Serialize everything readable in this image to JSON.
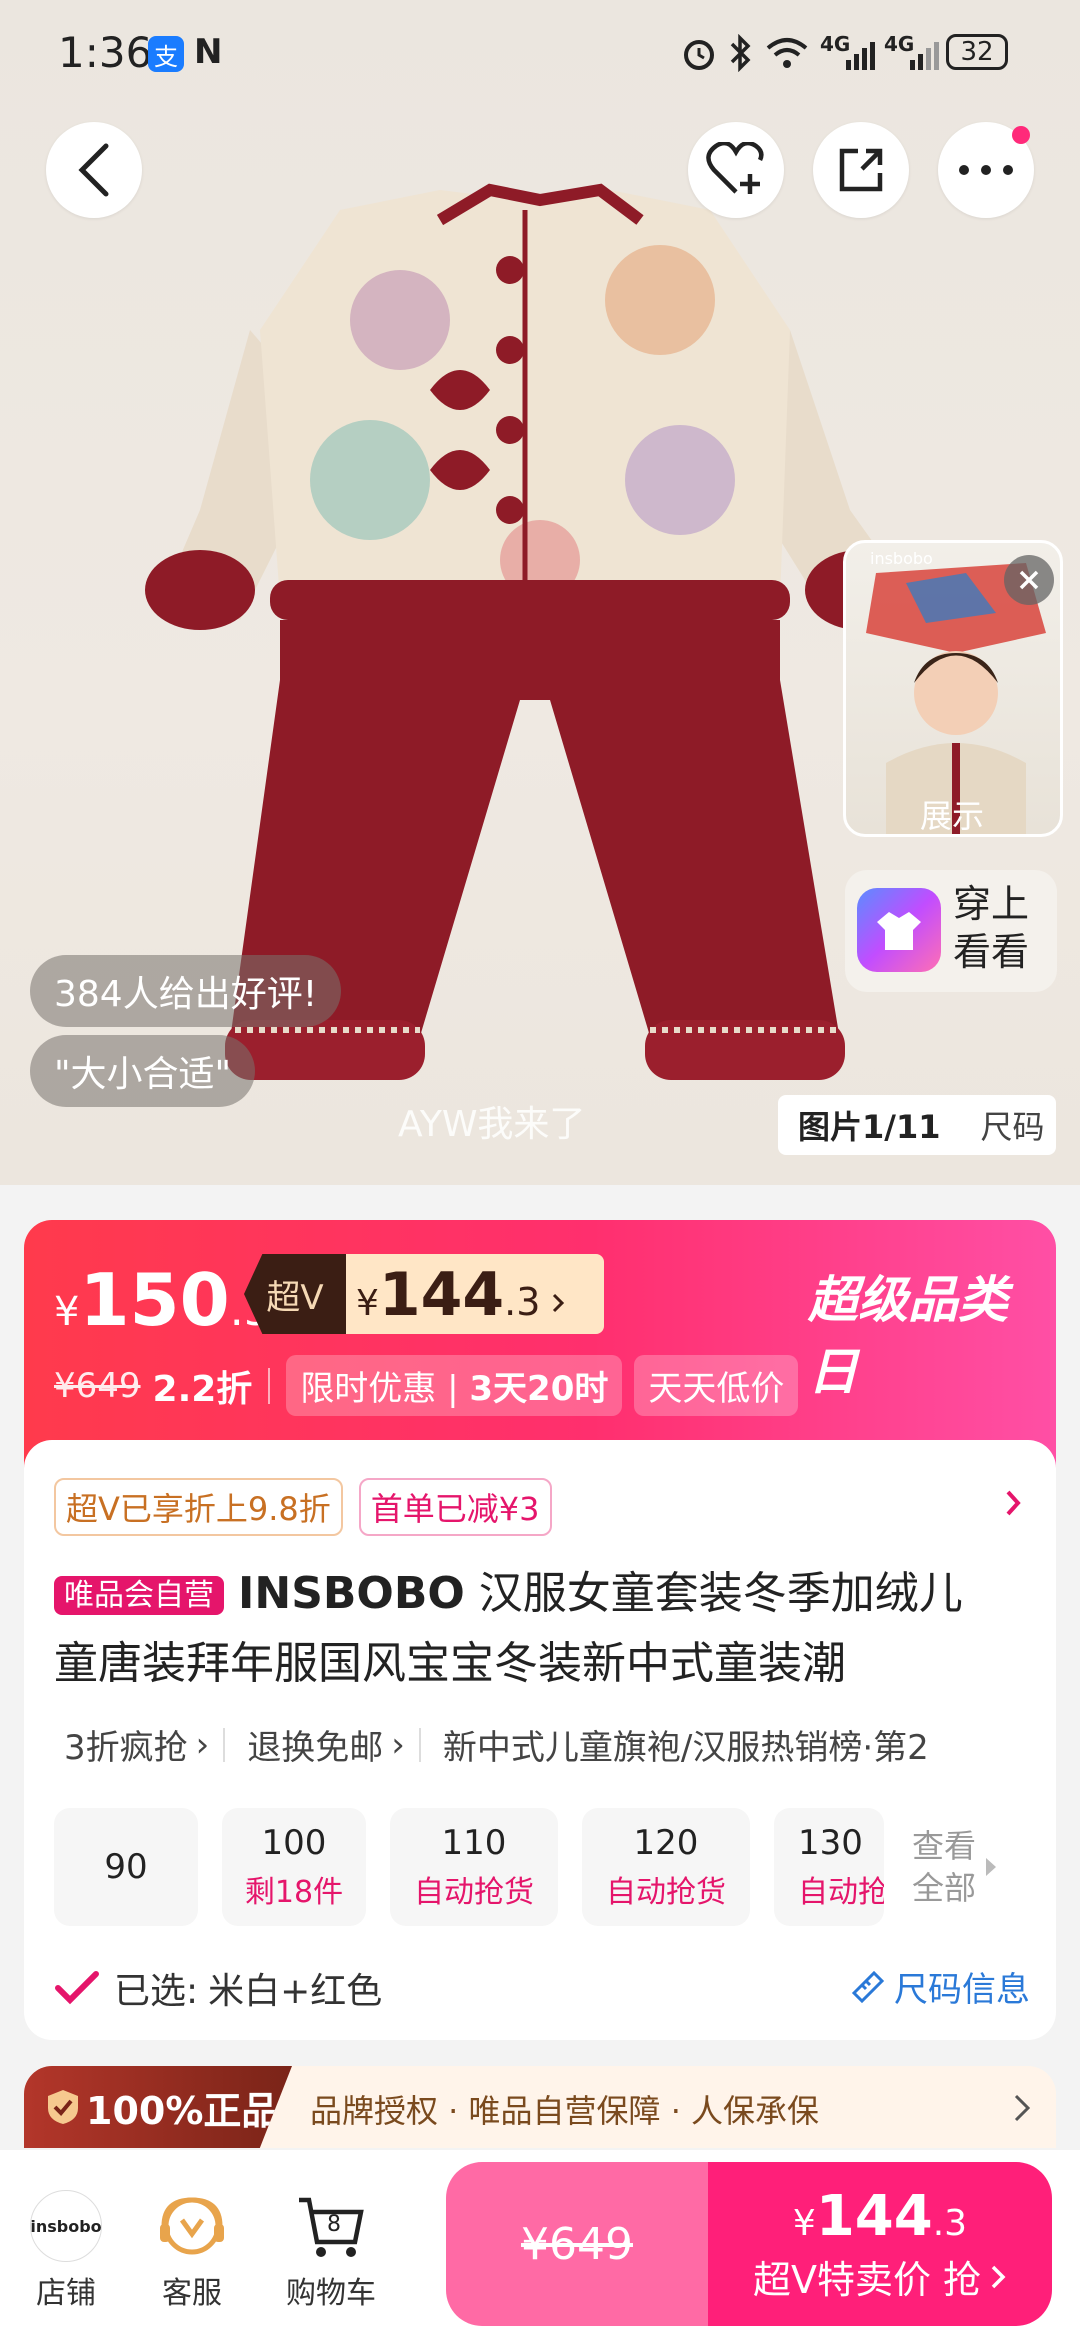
{
  "status_bar": {
    "time": "1:36",
    "alipay_badge": "支",
    "nfc": "N",
    "signal1": "4G",
    "signal2": "4G",
    "battery": "32"
  },
  "header": {
    "back_icon": "chevron-left-icon",
    "fav_icon": "heart-plus-icon",
    "share_icon": "share-icon",
    "more_icon": "more-dots-icon"
  },
  "hero": {
    "review_pill": "384人给出好评!",
    "comment_pill": "\"大小合适\"",
    "watermark": "AYW我来了",
    "thumb_brand": "insbobo",
    "thumb_label": "展示",
    "tryon_label1": "穿上",
    "tryon_label2": "看看",
    "image_counter": "图片1/11",
    "size_tab": "尺码"
  },
  "price": {
    "currency": "¥",
    "price_main": "150",
    "price_decimal": ".3",
    "superv_label": "超V",
    "superv_price_main": "144",
    "superv_price_decimal": ".3",
    "event_title": "超级品类日",
    "original_price": "¥649",
    "discount": "2.2折",
    "limited_label": "限时优惠",
    "limited_time": "3天20时",
    "daily_low": "天天低价"
  },
  "product": {
    "tag1": "超V已享折上9.8折",
    "tag2": "首单已减¥3",
    "self_badge": "唯品会自营",
    "title_brand": "INSBOBO",
    "title_line1": "汉服女童套装冬季加绒儿",
    "title_line2": "童唐装拜年服国风宝宝冬装新中式童装潮",
    "service1": "3折疯抢",
    "service2": "退换免邮",
    "service3": "新中式儿童旗袍/汉服热销榜·第2",
    "sizes": [
      {
        "size": "90",
        "status": ""
      },
      {
        "size": "100",
        "status": "剩18件"
      },
      {
        "size": "110",
        "status": "自动抢货"
      },
      {
        "size": "120",
        "status": "自动抢货"
      },
      {
        "size": "130",
        "status": "自动抢"
      }
    ],
    "view_all_1": "查看",
    "view_all_2": "全部",
    "selected_label": "已选:",
    "selected_value": "米白+红色",
    "size_info": "尺码信息"
  },
  "assurance": {
    "genuine": "100%正品",
    "text": "品牌授权 · 唯品自营保障 · 人保承保"
  },
  "bottom_bar": {
    "store_logo": "insbobo",
    "store_label": "店铺",
    "service_label": "客服",
    "cart_count": "8",
    "cart_label": "购物车",
    "orig_price": "¥649",
    "buy_price_main": "144",
    "buy_price_decimal": ".3",
    "buy_currency": "¥",
    "buy_label": "超V特卖价 抢"
  },
  "colors": {
    "accent_pink": "#ff2a7a",
    "banner_red": "#ff3a4c",
    "tag_orange": "#c87023",
    "price_pink": "#e5156b"
  }
}
